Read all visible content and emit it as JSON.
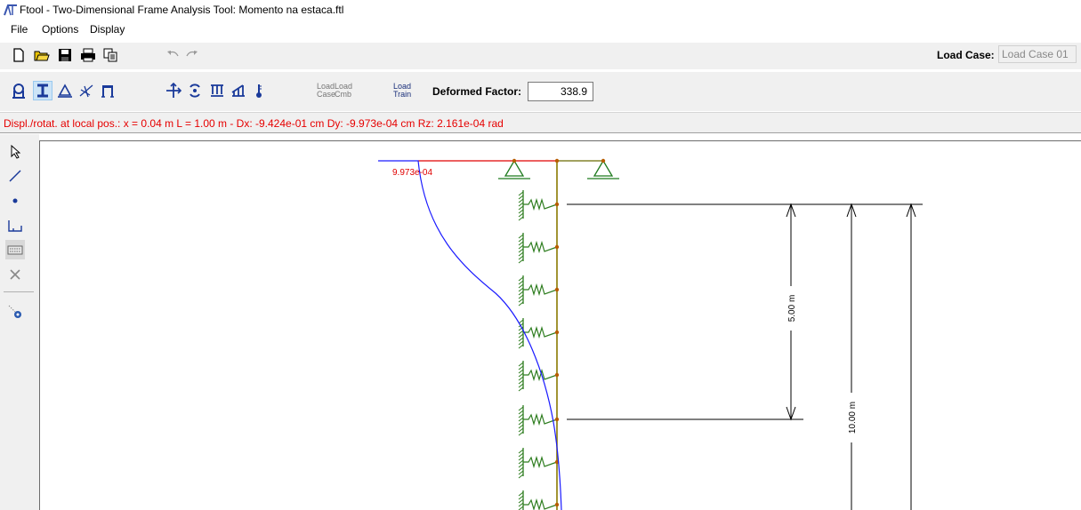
{
  "window": {
    "title": "Ftool - Two-Dimensional Frame Analysis Tool: Momento na estaca.ftl"
  },
  "menu": {
    "items": [
      "File",
      "Options",
      "Display"
    ]
  },
  "toolbar": {
    "load_case_label": "Load Case:",
    "load_case_value": "Load Case 01",
    "load_case_button": [
      "Load",
      "Case"
    ],
    "load_cmb_button": [
      "Load",
      "Cmb"
    ],
    "load_train_button": [
      "Load",
      "Train"
    ],
    "deformed_factor_label": "Deformed Factor:",
    "deformed_factor_value": "338.9"
  },
  "status": {
    "text": "Displ./rotat. at local pos.: x = 0.04 m  L = 1.00 m  -  Dx: -9.424e-01 cm  Dy: -9.973e-04 cm  Rz: 2.161e-04 rad"
  },
  "canvas": {
    "top_annotation": "9.973e-04",
    "dim_labels": [
      "5.00 m",
      "10.00 m"
    ]
  },
  "colors": {
    "status_red": "#e60000",
    "member": "#8a7a00",
    "spring": "#2e7d1f",
    "deformed_curve": "#1a1aff",
    "top_beam": "#e00000",
    "support": "#1e7a1e",
    "node": "#b85c00"
  }
}
